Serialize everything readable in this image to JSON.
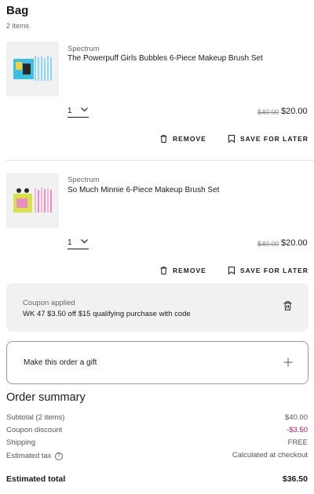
{
  "bag": {
    "title": "Bag",
    "count": "2 items"
  },
  "items": [
    {
      "brand": "Spectrum",
      "name": "The Powerpuff Girls Bubbles 6-Piece Makeup Brush Set",
      "qty": "1",
      "price_old": "$40.00",
      "price_new": "$20.00",
      "remove_label": "REMOVE",
      "save_label": "SAVE FOR LATER",
      "thumb_colors": [
        "#3cbfe6",
        "#f2d23c",
        "#2a2a2a",
        "#8fd6ef"
      ]
    },
    {
      "brand": "Spectrum",
      "name": "So Much Minnie 6-Piece Makeup Brush Set",
      "qty": "1",
      "price_old": "$40.00",
      "price_new": "$20.00",
      "remove_label": "REMOVE",
      "save_label": "SAVE FOR LATER",
      "thumb_colors": [
        "#e98cc6",
        "#d8e04a",
        "#2a2a2a",
        "#f3b3da"
      ]
    }
  ],
  "coupon": {
    "label": "Coupon applied",
    "description": "WK 47 $3.50 off $15 qualifying purchase with code"
  },
  "gift": {
    "label": "Make this order a gift"
  },
  "summary": {
    "title": "Order summary",
    "rows": [
      {
        "label": "Subtotal (2 items)",
        "value": "$40.00"
      },
      {
        "label": "Coupon discount",
        "value": "-$3.50"
      },
      {
        "label": "Shipping",
        "value": "FREE"
      },
      {
        "label": "Estimated tax",
        "value": "Calculated at checkout"
      }
    ],
    "total_label": "Estimated total",
    "total_value": "$36.50"
  },
  "colors": {
    "discount": "#b0126c",
    "coupon_bg": "#f1f1f1",
    "divider": "#e2e2e2"
  }
}
